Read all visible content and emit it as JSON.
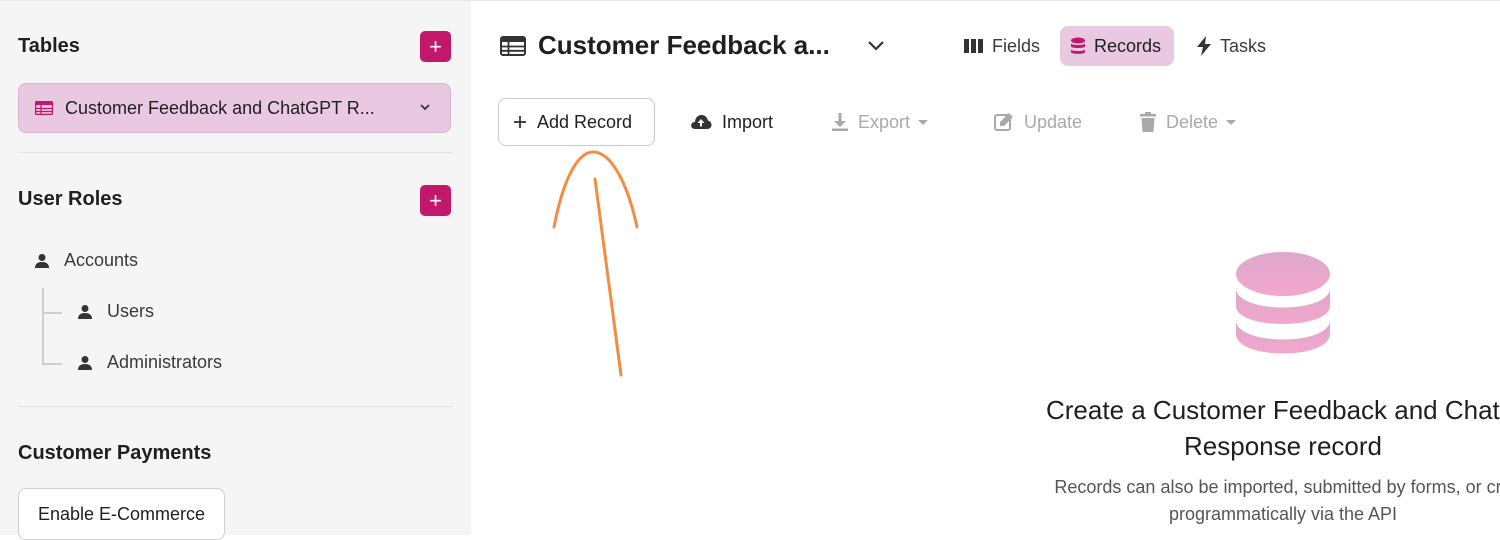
{
  "sidebar": {
    "tables_title": "Tables",
    "table_item_label": "Customer Feedback and ChatGPT R...",
    "user_roles_title": "User Roles",
    "roles": [
      {
        "label": "Accounts"
      },
      {
        "label": "Users"
      },
      {
        "label": "Administrators"
      }
    ],
    "payments_title": "Customer Payments",
    "ecommerce_button": "Enable E-Commerce"
  },
  "header": {
    "title": "Customer Feedback a...",
    "tabs": [
      {
        "label": "Fields",
        "icon": "columns-icon"
      },
      {
        "label": "Records",
        "icon": "database-icon",
        "active": true
      },
      {
        "label": "Tasks",
        "icon": "bolt-icon"
      }
    ]
  },
  "toolbar": {
    "add_record": "Add Record",
    "import": "Import",
    "export": "Export",
    "update": "Update",
    "delete": "Delete"
  },
  "empty_state": {
    "title_line1": "Create a Customer Feedback and ChatG",
    "title_line2": "Response record",
    "sub_line1": "Records can also be imported, submitted by forms, or cre",
    "sub_line2": "programmatically via the API"
  },
  "colors": {
    "accent": "#c2186b",
    "active_bg": "#e9c8e2",
    "annotation": "#f28c45"
  }
}
